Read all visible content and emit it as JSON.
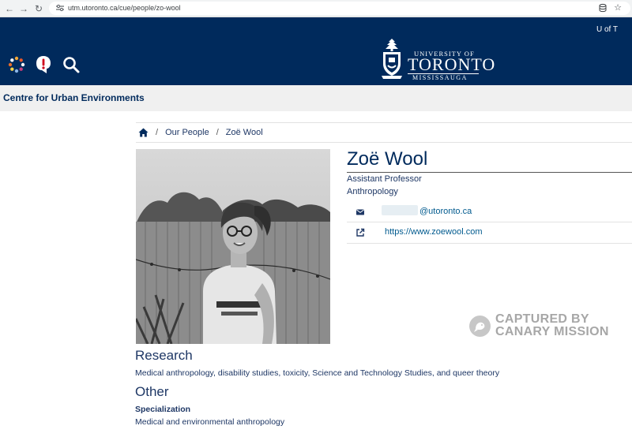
{
  "browser": {
    "url": "utm.utoronto.ca/cue/people/zo-wool"
  },
  "header": {
    "uoft_link": "U of T",
    "logo_university_of": "UNIVERSITY OF",
    "logo_toronto": "TORONTO",
    "logo_mississauga": "MISSISSAUGA"
  },
  "section": {
    "title": "Centre for Urban Environments"
  },
  "breadcrumb": {
    "items": [
      "Our People",
      "Zoë Wool"
    ],
    "separator": "/"
  },
  "profile": {
    "name": "Zoë Wool",
    "title": "Assistant Professor",
    "department": "Anthropology",
    "email_domain": "@utoronto.ca",
    "website": "https://www.zoewool.com"
  },
  "watermark": {
    "line1": "CAPTURED BY",
    "line2": "CANARY MISSION"
  },
  "research": {
    "heading": "Research",
    "text": "Medical anthropology, disability studies, toxicity, Science and Technology Studies, and queer theory"
  },
  "other": {
    "heading": "Other",
    "specialization_label": "Specialization",
    "specialization_text": "Medical and environmental anthropology"
  },
  "colors": {
    "header_blue": "#002a5c",
    "link_blue": "#005a8e",
    "section_bar": "#f0f0f0"
  }
}
